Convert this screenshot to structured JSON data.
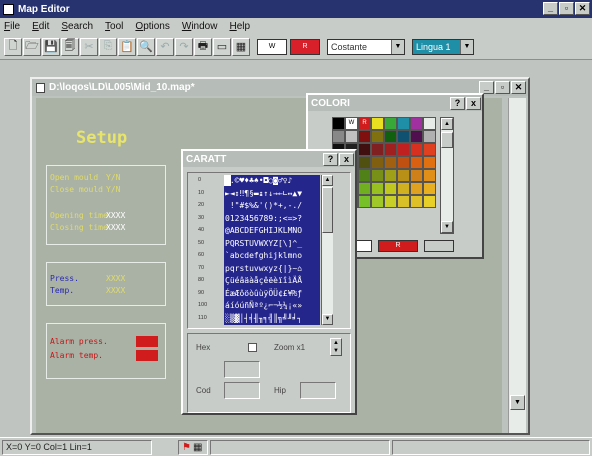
{
  "app": {
    "title": "Map Editor"
  },
  "menu": [
    "File",
    "Edit",
    "Search",
    "Tool",
    "Options",
    "Window",
    "Help"
  ],
  "toolbar": {
    "swatch_fg": "W",
    "swatch_bg": "R",
    "font_combo": "Costante",
    "lang_combo": "Lingua 1"
  },
  "map_window": {
    "title": "D:\\loqos\\LD\\L005\\Mid_10.map*",
    "setup_label": "Setup",
    "lines1": [
      {
        "label": "Open mould",
        "value": "Y/N"
      },
      {
        "label": "Close mould",
        "value": "Y/N"
      }
    ],
    "lines2": [
      {
        "label": "Opening time",
        "value": "XXXX"
      },
      {
        "label": "Closing time",
        "value": "XXXX"
      }
    ],
    "lines3": [
      {
        "label": "Press.",
        "value": "XXXX"
      },
      {
        "label": "Temp.",
        "value": "XXXX"
      }
    ],
    "lines4": [
      {
        "label": "Alarm press."
      },
      {
        "label": "Alarm temp."
      }
    ]
  },
  "color_window": {
    "title": "COLORI",
    "help": "?",
    "close": "x",
    "palette": [
      [
        "#000000",
        "#ffffff",
        "#d01c1c",
        "#e8e020",
        "#38a838",
        "#1f8fa8",
        "#a030a0",
        "#e8ece8"
      ],
      [
        "#888888",
        "#c0c0c0",
        "#801010",
        "#807010",
        "#106010",
        "#105070",
        "#501050",
        "#b0b0b0"
      ],
      [
        "#101010",
        "#202020",
        "#401010",
        "#802020",
        "#a02020",
        "#c02020",
        "#d83020",
        "#e04020"
      ],
      [
        "#183018",
        "#304010",
        "#505010",
        "#806010",
        "#a06010",
        "#c05010",
        "#d86010",
        "#e07010"
      ],
      [
        "#206020",
        "#307018",
        "#508018",
        "#789018",
        "#a0a018",
        "#b89018",
        "#d08018",
        "#e09018"
      ],
      [
        "#308830",
        "#48a020",
        "#70b020",
        "#98c020",
        "#c0c820",
        "#d0b020",
        "#e0a020",
        "#e8b020"
      ],
      [
        "#38a838",
        "#50b828",
        "#78c028",
        "#a0c828",
        "#c8d028",
        "#d8c028",
        "#e0c028",
        "#e8d028"
      ]
    ],
    "fg_label": "W",
    "bg_label": "R"
  },
  "caratt_window": {
    "title": "CARATT",
    "help": "?",
    "close": "x",
    "row_labels": [
      "0",
      "10",
      "20",
      "30",
      "40",
      "50",
      "60",
      "70",
      "80",
      "90",
      "100",
      "110"
    ],
    "charmap_rows": [
      " .©♥♦♣♠•◘○◙♂♀♪ ",
      "►◄↕‼¶§▬↨↑↓→←∟↔▲▼",
      " !\"#$%&'()*+,-./",
      "0123456789:;<=>?",
      "@ABCDEFGHIJKLMNO",
      "PQRSTUVWXYZ[\\]^_",
      "`abcdefghijklmno",
      "pqrstuvwxyz{|}~⌂",
      "ÇüéâäàåçêëèïîìÄÅ",
      "ÉæÆôöòûùÿÖÜ¢£¥₧ƒ",
      "áíóúñÑªº¿⌐¬½¼¡«»",
      "░▒▓│┤╡╢╖╕╣║╗╝╜╛┐"
    ],
    "hex_label": "Hex",
    "zoom_label": "Zoom x1",
    "cod_label": "Cod",
    "hip_label": "Hip"
  },
  "statusbar": {
    "pos": "X=0 Y=0  Col=1 Lin=1"
  }
}
